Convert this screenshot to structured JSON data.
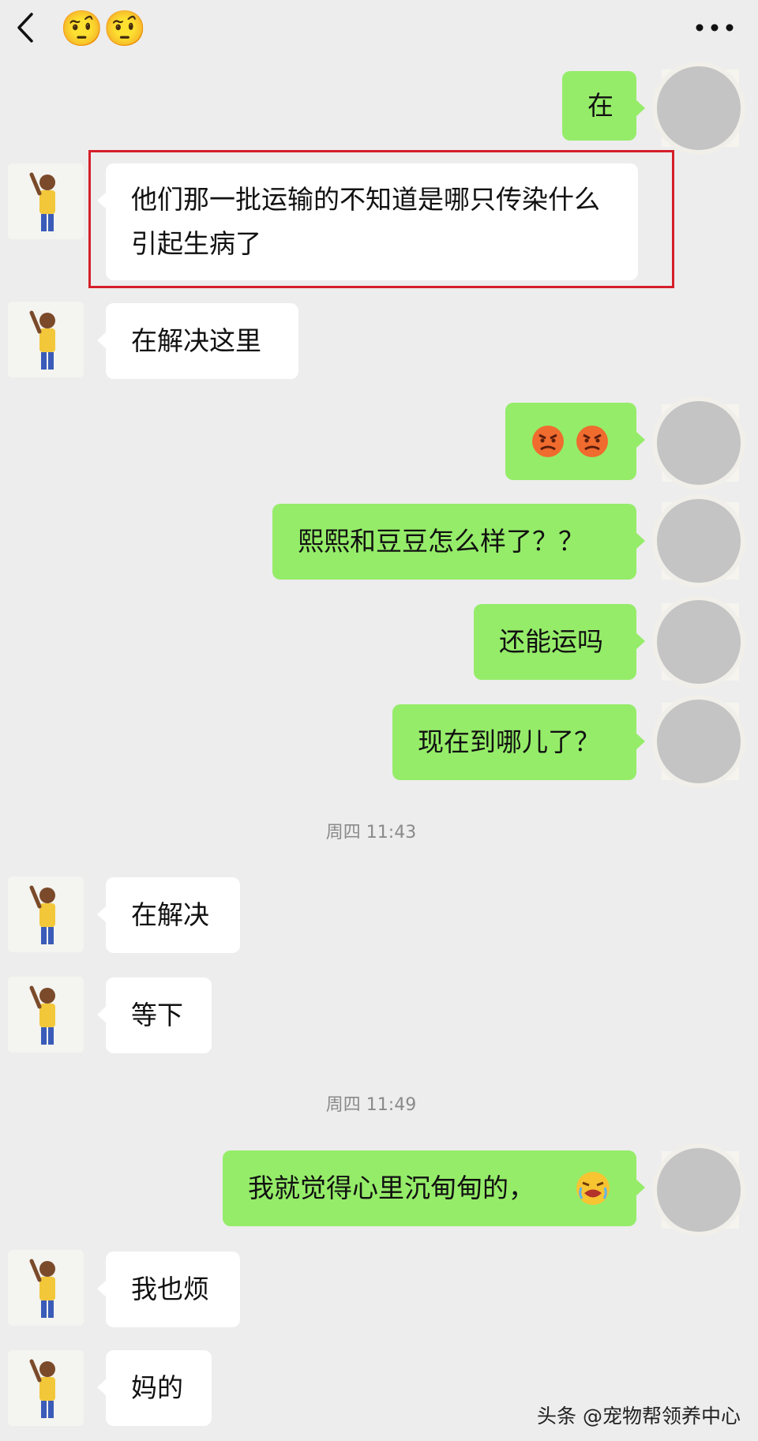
{
  "header": {
    "back_icon": "chevron-left-icon",
    "title": "🤨🤨",
    "more_icon": "more-dots-icon"
  },
  "messages": [
    {
      "side": "out",
      "text": "在"
    },
    {
      "side": "in",
      "text": "他们那一批运输的不知道是哪只传染什么引起生病了",
      "highlighted": true
    },
    {
      "side": "in",
      "text": "在解决这里"
    },
    {
      "side": "out",
      "text": "😡😡",
      "emoji_only": true,
      "icon": "angry-face-icon"
    },
    {
      "side": "out",
      "text": "熙熙和豆豆怎么样了？？"
    },
    {
      "side": "out",
      "text": "还能运吗"
    },
    {
      "side": "out",
      "text": "现在到哪儿了？"
    },
    {
      "side": "time",
      "text": "周四 11:43"
    },
    {
      "side": "in",
      "text": "在解决"
    },
    {
      "side": "in",
      "text": "等下"
    },
    {
      "side": "time",
      "text": "周四 11:49"
    },
    {
      "side": "out",
      "text": "我就觉得心里沉甸甸的，",
      "trailing_icon": "crying-face-icon"
    },
    {
      "side": "in",
      "text": "我也烦"
    },
    {
      "side": "in",
      "text": "妈的"
    }
  ],
  "watermark": "头条 @宠物帮领养中心",
  "colors": {
    "background": "#ededed",
    "bubble_in": "#ffffff",
    "bubble_out": "#95ec69",
    "highlight": "#d51f2a"
  }
}
